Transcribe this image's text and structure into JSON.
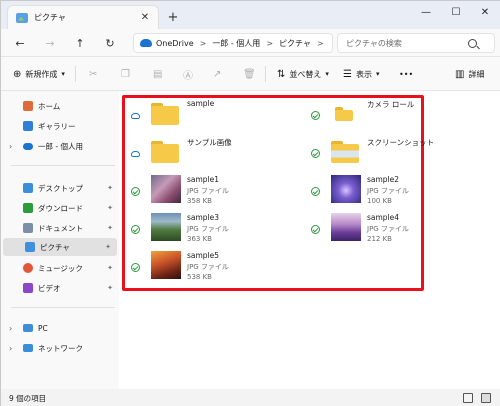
{
  "window": {
    "tab_title": "ピクチャ",
    "new_tab": "+",
    "controls": [
      "—",
      "☐",
      "✕"
    ]
  },
  "nav": {
    "back": "←",
    "forward": "→",
    "up": "↑",
    "refresh": "↻"
  },
  "address": {
    "crumbs": [
      "OneDrive",
      "一郎 - 個人用",
      "ピクチャ"
    ],
    "separator": ">"
  },
  "search": {
    "placeholder": "ピクチャの検索"
  },
  "toolbar": {
    "new_label": "新規作成",
    "sort_label": "並べ替え",
    "view_label": "表示",
    "more_label": "•••",
    "details_label": "詳細"
  },
  "sidebar": {
    "items": [
      {
        "label": "ホーム",
        "icon": "home-icon",
        "color": "#e06b3a"
      },
      {
        "label": "ギャラリー",
        "icon": "gallery-icon",
        "color": "#2f7fd6"
      },
      {
        "label": "一郎 - 個人用",
        "icon": "onedrive-icon",
        "color": "#1a73d1"
      },
      {
        "label": "デスクトップ",
        "icon": "desktop-icon",
        "color": "#3b8ed8"
      },
      {
        "label": "ダウンロード",
        "icon": "download-icon",
        "color": "#2d9a3c"
      },
      {
        "label": "ドキュメント",
        "icon": "document-icon",
        "color": "#7b8fa6"
      },
      {
        "label": "ピクチャ",
        "icon": "pictures-icon",
        "color": "#3d8fe0"
      },
      {
        "label": "ミュージック",
        "icon": "music-icon",
        "color": "#e3573a"
      },
      {
        "label": "ビデオ",
        "icon": "video-icon",
        "color": "#8c47c7"
      },
      {
        "label": "PC",
        "icon": "pc-icon",
        "color": "#3b8ed8"
      },
      {
        "label": "ネットワーク",
        "icon": "network-icon",
        "color": "#3b8ed8"
      }
    ],
    "pin": "📌"
  },
  "files": [
    {
      "name": "sample",
      "type": "",
      "size": "",
      "kind": "folder",
      "sync": "cloud"
    },
    {
      "name": "カメラ ロール",
      "type": "",
      "size": "",
      "kind": "folder-small",
      "sync": "check"
    },
    {
      "name": "サンプル画像",
      "type": "",
      "size": "",
      "kind": "folder",
      "sync": "cloud"
    },
    {
      "name": "スクリーンショット",
      "type": "",
      "size": "",
      "kind": "folder-shot",
      "sync": "check"
    },
    {
      "name": "sample1",
      "type": "JPG ファイル",
      "size": "358 KB",
      "kind": "image",
      "sync": "check",
      "thumb": "linear-gradient(135deg,#6f6a8a 0%,#c59ab6 40%,#8b4c6e 70%,#3b2a3e 100%)"
    },
    {
      "name": "sample2",
      "type": "JPG ファイル",
      "size": "100 KB",
      "kind": "image",
      "sync": "check",
      "thumb": "radial-gradient(circle at 50% 55%,#d9c6ff 0%,#7b5fd1 35%,#2a2675 100%)"
    },
    {
      "name": "sample3",
      "type": "JPG ファイル",
      "size": "363 KB",
      "kind": "image",
      "sync": "check",
      "thumb": "linear-gradient(180deg,#6d8fb5 0%,#9fb9c9 30%,#4f7a3e 60%,#2f4a24 100%)"
    },
    {
      "name": "sample4",
      "type": "JPG ファイル",
      "size": "212 KB",
      "kind": "image",
      "sync": "check",
      "thumb": "linear-gradient(180deg,#e7d3ea 0%,#b689c8 40%,#6a3c98 70%,#3b2366 100%)"
    },
    {
      "name": "sample5",
      "type": "JPG ファイル",
      "size": "538 KB",
      "kind": "image",
      "sync": "check",
      "thumb": "linear-gradient(160deg,#f2a23b 0%,#c9542a 40%,#6b2316 75%,#2a120c 100%)"
    }
  ],
  "status": {
    "count": "9 個の項目"
  },
  "colors": {
    "highlight": "#e8101d",
    "accent": "#1a73d1",
    "check": "#2d9a3c"
  }
}
